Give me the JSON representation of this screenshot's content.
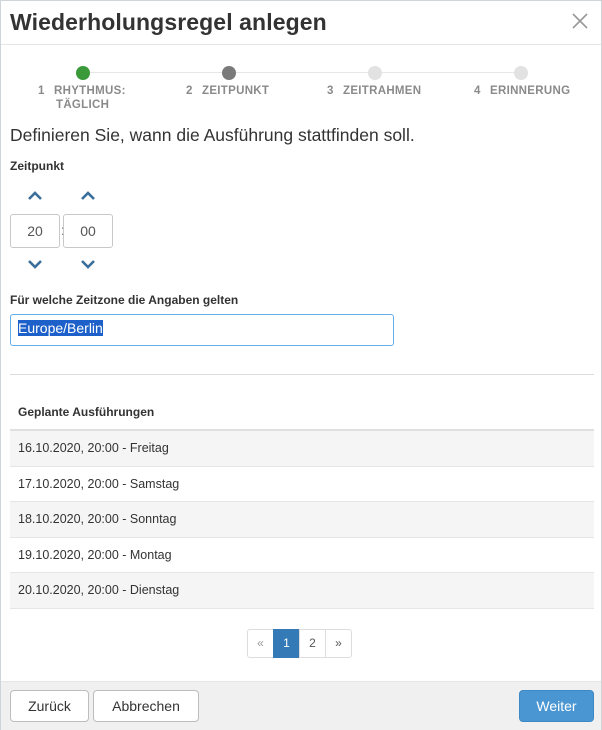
{
  "dialog": {
    "title": "Wiederholungsregel anlegen"
  },
  "steps": [
    {
      "num": "1",
      "label": "RHYTHMUS:",
      "sub": "TÄGLICH",
      "state": "done"
    },
    {
      "num": "2",
      "label": "ZEITPUNKT",
      "sub": "",
      "state": "active"
    },
    {
      "num": "3",
      "label": "ZEITRAHMEN",
      "sub": "",
      "state": "todo"
    },
    {
      "num": "4",
      "label": "ERINNERUNG",
      "sub": "",
      "state": "todo"
    }
  ],
  "colors": {
    "done": "#3a9a3a",
    "active": "#7a7a7a",
    "todo": "#e2e2e2",
    "accent": "#337ab7",
    "primary_button": "#4a96d2",
    "chevron": "#3a6f9b"
  },
  "main": {
    "heading": "Definieren Sie, wann die Ausführung stattfinden soll.",
    "time_label": "Zeitpunkt",
    "hours": "20",
    "minutes": "00",
    "separator": ":",
    "timezone_label": "Für welche Zeitzone die Angaben gelten",
    "timezone_value": "Europe/Berlin"
  },
  "table": {
    "header": "Geplante Ausführungen",
    "rows": [
      "16.10.2020, 20:00 - Freitag",
      "17.10.2020, 20:00 - Samstag",
      "18.10.2020, 20:00 - Sonntag",
      "19.10.2020, 20:00 - Montag",
      "20.10.2020, 20:00 - Dienstag"
    ]
  },
  "pagination": {
    "prev": "«",
    "pages": [
      "1",
      "2"
    ],
    "next": "»",
    "current": "1"
  },
  "footer": {
    "back": "Zurück",
    "cancel": "Abbrechen",
    "next": "Weiter"
  },
  "icons": {
    "close": "close-icon",
    "up": "chevron-up-icon",
    "down": "chevron-down-icon"
  }
}
